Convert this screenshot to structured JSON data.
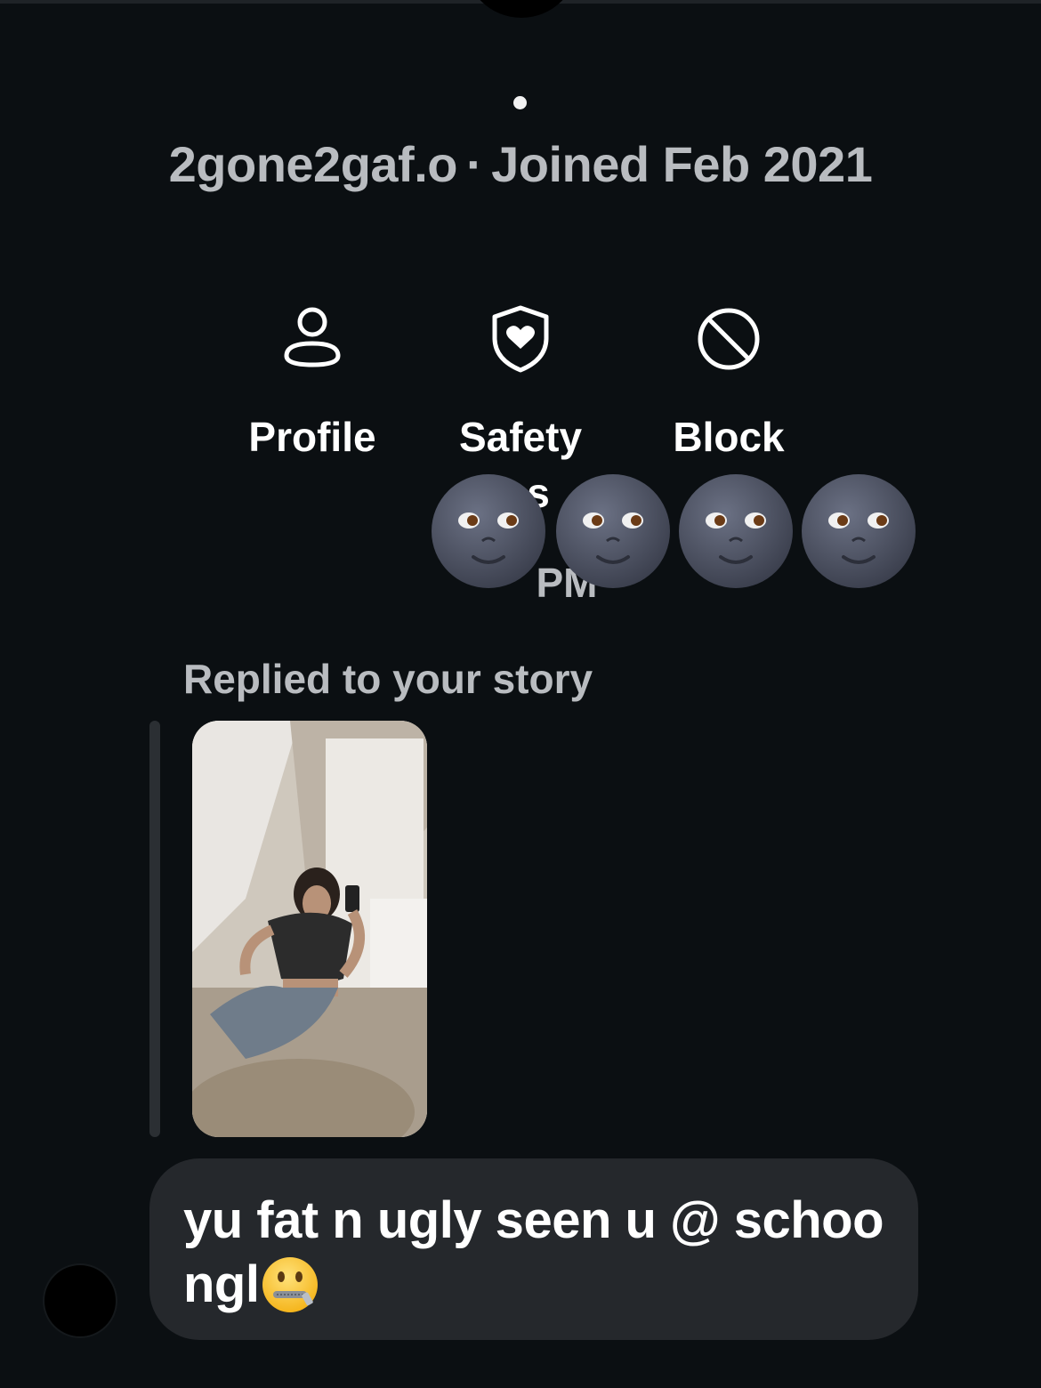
{
  "header": {
    "username": "2gone2gaf.o",
    "separator": "·",
    "joined": "Joined Feb 2021"
  },
  "actions": [
    {
      "label": "Profile",
      "icon": "person-icon"
    },
    {
      "label": "Safety",
      "icon": "shield-heart-icon"
    },
    {
      "label": "Block",
      "icon": "block-icon"
    }
  ],
  "partially_hidden": {
    "safety_sub_label": "s",
    "time": "PM"
  },
  "overlay": {
    "emoji": "new-moon-face",
    "count": 4
  },
  "story_reply": {
    "label": "Replied to your story"
  },
  "message": {
    "line1": "yu fat n ugly seen u @ schoo",
    "line2": "ngl",
    "emoji": "zipper-mouth-face"
  },
  "colors": {
    "background": "#0b0f12",
    "bubble": "#25282c",
    "secondary_text": "#b9bcc0",
    "primary_text": "#ffffff"
  }
}
